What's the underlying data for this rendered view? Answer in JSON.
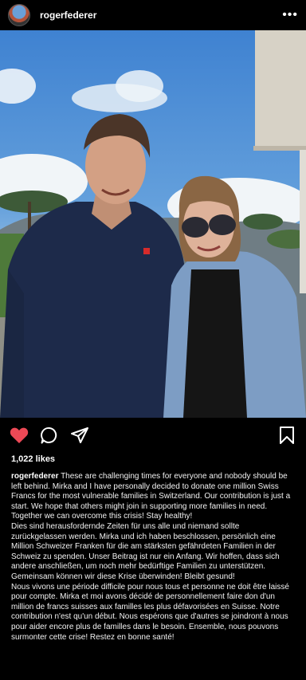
{
  "post": {
    "username": "rogerfederer",
    "more_icon": "more-horizontal-icon",
    "likes": "1,022 likes",
    "caption_en": "These are challenging times for everyone and nobody should be left behind. Mirka and I have personally decided to donate one million Swiss Francs for the most vulnerable families in Switzerland. Our contribution is just a start. We hope that others might join in supporting more families in need. Together we can overcome this crisis! Stay healthy!",
    "caption_de": "Dies sind herausfordernde Zeiten für uns alle und niemand sollte zurückgelassen werden. Mirka und ich haben beschlossen, persönlich eine Million Schweizer Franken für die am stärksten gefährdeten Familien in der Schweiz zu spenden. Unser Beitrag ist nur ein Anfang. Wir hoffen, dass sich andere anschließen, um noch mehr bedürftige Familien zu unterstützen. Gemeinsam können wir diese Krise überwinden! Bleibt gesund!",
    "caption_fr": "Nous vivons une période difficile pour nous tous et personne ne doit être laissé pour compte. Mirka et moi avons décidé de personnellement faire don d'un million de francs suisses aux familles les plus défavorisées en Suisse. Notre contribution n'est qu'un début. Nous espérons que d'autres se joindront à nous pour aider encore plus de familles dans le besoin. Ensemble, nous pouvons surmonter cette crise! Restez en bonne santé!"
  },
  "icons": {
    "like": "heart-icon",
    "comment": "comment-icon",
    "share": "share-icon",
    "save": "bookmark-icon"
  },
  "colors": {
    "background": "#000000",
    "like_active": "#ed4956",
    "text": "#ffffff"
  }
}
